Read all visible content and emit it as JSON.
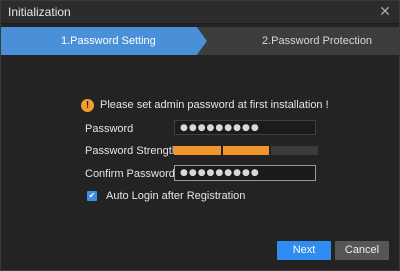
{
  "window": {
    "title": "Initialization",
    "close_glyph": "✕"
  },
  "steps": [
    {
      "label": "1.Password Setting",
      "active": true
    },
    {
      "label": "2.Password Protection",
      "active": false
    }
  ],
  "notice": {
    "icon": "warning-icon",
    "icon_glyph": "!",
    "text": "Please set admin password at first installation !"
  },
  "form": {
    "password_label": "Password",
    "password_value": "●●●●●●●●●",
    "strength_label": "Password Strength",
    "strength_segments_filled": 2,
    "strength_segments_total": 3,
    "confirm_label": "Confirm Password",
    "confirm_value": "●●●●●●●●●",
    "auto_login_label": "Auto Login after Registration",
    "auto_login_checked": true,
    "checkbox_glyph": "✔"
  },
  "buttons": {
    "next": "Next",
    "cancel": "Cancel"
  },
  "colors": {
    "accent": "#4a90d9",
    "button_primary": "#2f8cf0",
    "strength": "#f0962a",
    "warning": "#f0a030",
    "background": "#232323"
  }
}
